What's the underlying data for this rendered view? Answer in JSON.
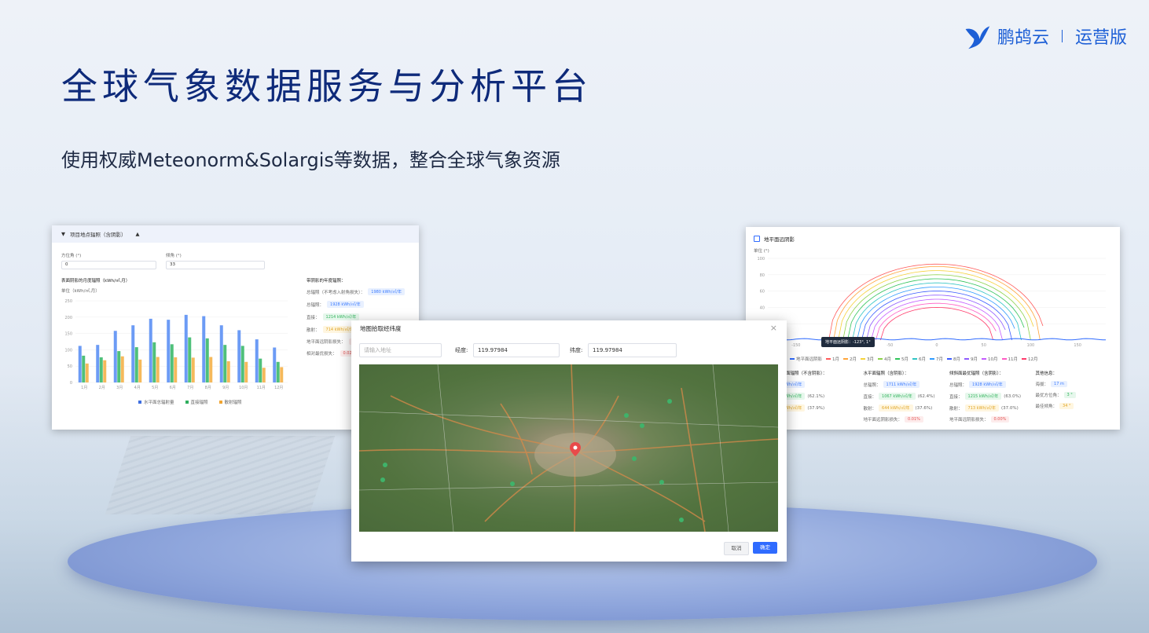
{
  "brand": {
    "name": "鹏鸪云",
    "edition": "运营版"
  },
  "hero": {
    "title": "全球气象数据服务与分析平台",
    "subtitle": "使用权威Meteonorm&Solargis等数据，整合全球气象资源"
  },
  "left_panel": {
    "section_title": "项目地点辐照（含阴影）",
    "azimuth_label": "方位角 (°)",
    "azimuth_value": "0",
    "tilt_label": "倾角 (°)",
    "tilt_value": "33",
    "chart_title": "表面阴影的月度辐照（kWh/㎡,月）",
    "chart_unit": "单位（kWh/㎡,月）",
    "legend": [
      "水平面总辐射量",
      "直接辐照",
      "散射辐照"
    ],
    "stats_title": "带阴影的年度辐照：",
    "stats": [
      {
        "label": "总辐照（不考虑入射角损失）：",
        "value": "1980 kWh/㎡/年",
        "tone": "blue"
      },
      {
        "label": "总辐照：",
        "value": "1928 kWh/㎡/年",
        "tone": "blue"
      },
      {
        "label": "直接：",
        "value": "1214 kWh/㎡/年",
        "tone": "green"
      },
      {
        "label": "散射：",
        "value": "714 kWh/㎡/年",
        "tone": "yellow"
      },
      {
        "label": "地平面远阴影损失：",
        "value": "0",
        "tone": "red"
      },
      {
        "label": "相对最优损失：",
        "value": "0.02%",
        "tone": "red"
      }
    ]
  },
  "right_panel": {
    "title": "地平面远阴影",
    "unit": "单位 (°)",
    "tooltip": "地平面远阴影：-123°, 1°",
    "legend": [
      "地平面远阴影",
      "1月",
      "2月",
      "3月",
      "4月",
      "5月",
      "6月",
      "7月",
      "8月",
      "9月",
      "10月",
      "11月",
      "12月"
    ],
    "legend_colors": [
      "#2f6bff",
      "#ff5a5a",
      "#ffa53b",
      "#f5d23b",
      "#8bd14a",
      "#2fc45a",
      "#2fc4c4",
      "#2f9bff",
      "#3b5bff",
      "#8f5bff",
      "#c45bff",
      "#ff5bc4",
      "#ff3b6b"
    ],
    "sections": [
      {
        "title": "水平面辐照（不含阴影）：",
        "rows": [
          {
            "label": "",
            "value": "kWh/㎡/年",
            "pct": ""
          },
          {
            "label": "",
            "value": "kWh/㎡/年",
            "pct": "(62.1%)"
          },
          {
            "label": "",
            "value": "kWh/㎡/年",
            "pct": "(37.9%)"
          }
        ]
      },
      {
        "title": "水平面辐照（含阴影）：",
        "rows": [
          {
            "label": "总辐照：",
            "value": "1711 kWh/㎡/年",
            "pct": ""
          },
          {
            "label": "直接：",
            "value": "1067 kWh/㎡/年",
            "pct": "(62.4%)"
          },
          {
            "label": "散射：",
            "value": "644 kWh/㎡/年",
            "pct": "(37.6%)"
          },
          {
            "label": "地平面远阴影损失：",
            "value": "0.01%",
            "pct": ""
          }
        ]
      },
      {
        "title": "倾斜面最优辐照（含阴影）：",
        "rows": [
          {
            "label": "总辐照：",
            "value": "1928 kWh/㎡/年",
            "pct": ""
          },
          {
            "label": "直接：",
            "value": "1215 kWh/㎡/年",
            "pct": "(63.0%)"
          },
          {
            "label": "散射：",
            "value": "713 kWh/㎡/年",
            "pct": "(37.0%)"
          },
          {
            "label": "地平面远阴影损失：",
            "value": "0.00%",
            "pct": ""
          }
        ]
      },
      {
        "title": "其他信息：",
        "rows": [
          {
            "label": "海拔：",
            "value": "17 m",
            "pct": ""
          },
          {
            "label": "最优方位角：",
            "value": "3 °",
            "pct": ""
          },
          {
            "label": "最佳倾角：",
            "value": "34 °",
            "pct": ""
          }
        ]
      }
    ]
  },
  "dialog": {
    "title": "地图拾取经纬度",
    "address_placeholder": "请输入地址",
    "longitude_label": "经度:",
    "longitude_value": "119.97984",
    "latitude_label": "纬度:",
    "latitude_value": "119.97984",
    "cancel_label": "取消",
    "ok_label": "确定"
  },
  "chart_data": [
    {
      "type": "bar",
      "title": "表面阴影的月度辐照（kWh/㎡,月）",
      "ylabel": "单位（kWh/㎡,月）",
      "ylim": [
        0,
        250
      ],
      "yticks": [
        0,
        50,
        100,
        150,
        200,
        250
      ],
      "categories": [
        "1月",
        "2月",
        "3月",
        "4月",
        "5月",
        "6月",
        "7月",
        "8月",
        "9月",
        "10月",
        "11月",
        "12月"
      ],
      "series": [
        {
          "name": "水平面总辐射量",
          "color": "#6c9bf5",
          "values": [
            112,
            115,
            158,
            175,
            195,
            192,
            207,
            203,
            175,
            160,
            132,
            107
          ]
        },
        {
          "name": "直接辐照",
          "color": "#4fc07a",
          "values": [
            82,
            77,
            96,
            108,
            123,
            117,
            138,
            135,
            115,
            112,
            73,
            63
          ]
        },
        {
          "name": "散射辐照",
          "color": "#f5b95b",
          "values": [
            58,
            68,
            80,
            70,
            78,
            77,
            76,
            78,
            65,
            63,
            45,
            47
          ]
        }
      ],
      "legend": "bottom"
    },
    {
      "type": "line",
      "title": "地平面远阴影",
      "ylabel": "单位 (°)",
      "xlim": [
        -180,
        180
      ],
      "ylim": [
        0,
        100
      ],
      "xticks": [
        -150,
        -100,
        -50,
        0,
        50,
        100,
        150
      ],
      "yticks": [
        20,
        40,
        60,
        80,
        100
      ],
      "series_peaks": [
        {
          "name": "1月",
          "peak": 93,
          "half_width": 115
        },
        {
          "name": "2月",
          "peak": 90,
          "half_width": 110
        },
        {
          "name": "3月",
          "peak": 85,
          "half_width": 105
        },
        {
          "name": "4月",
          "peak": 80,
          "half_width": 100
        },
        {
          "name": "5月",
          "peak": 75,
          "half_width": 95
        },
        {
          "name": "6月",
          "peak": 70,
          "half_width": 90
        },
        {
          "name": "7月",
          "peak": 65,
          "half_width": 85
        },
        {
          "name": "8月",
          "peak": 60,
          "half_width": 80
        },
        {
          "name": "9月",
          "peak": 55,
          "half_width": 75
        },
        {
          "name": "10月",
          "peak": 50,
          "half_width": 70
        },
        {
          "name": "11月",
          "peak": 45,
          "half_width": 65
        },
        {
          "name": "12月",
          "peak": 40,
          "half_width": 60
        }
      ],
      "horizon_series": {
        "name": "地平面远阴影",
        "level": 1
      },
      "legend": "bottom"
    }
  ]
}
